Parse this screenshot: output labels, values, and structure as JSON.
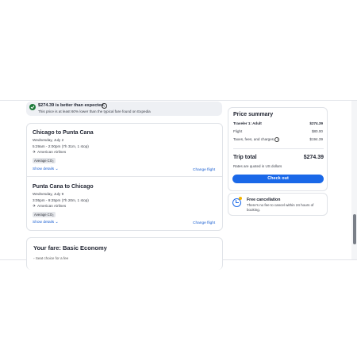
{
  "banner": {
    "title": "$274.39 is better than expected",
    "info_icon": "i",
    "subtitle": "This price is at least 60% lower than the typical fare found on Expedia"
  },
  "flights": [
    {
      "route": "Chicago to Punta Cana",
      "date": "Wednesday, July 2",
      "time": "5:29am - 2:00pm (7h 31m, 1 stop)",
      "airline": "American Airlines",
      "badge": "Average CO₂",
      "show_details": "Show details",
      "change": "Change flight"
    },
    {
      "route": "Punta Cana to Chicago",
      "date": "Wednesday, July 9",
      "time": "3:05pm - 9:25pm (7h 20m, 1 stop)",
      "airline": "American Airlines",
      "badge": "Average CO₂",
      "show_details": "Show details",
      "change": "Change flight"
    }
  ],
  "fare": {
    "title": "Your fare: Basic Economy",
    "first_item": "Seat choice for a fee"
  },
  "summary": {
    "title": "Price summary",
    "traveler_label": "Traveler 1: Adult",
    "traveler_value": "$274.39",
    "flight_label": "Flight",
    "flight_value": "$80.00",
    "taxes_label": "Taxes, fees, and charges",
    "taxes_value": "$194.39",
    "total_label": "Trip total",
    "total_value": "$274.39",
    "rates_note": "Rates are quoted in US dollars",
    "checkout": "Check out"
  },
  "cancellation": {
    "title": "Free cancellation",
    "text": "There's no fee to cancel within 24 hours of booking."
  },
  "colors": {
    "accent": "#1a68e8",
    "success": "#1d7a3a",
    "link": "#1a5fd1"
  }
}
